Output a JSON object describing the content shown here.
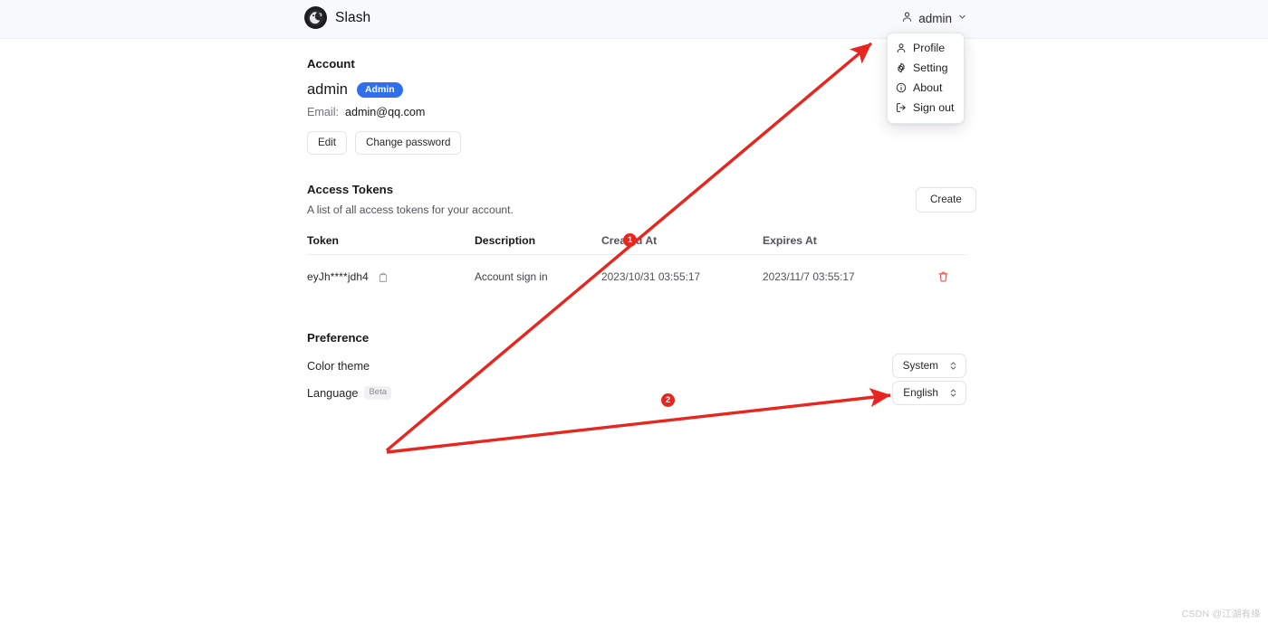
{
  "header": {
    "brand_name": "Slash",
    "logo_icon": "slash-globe-logo",
    "user_name": "admin",
    "user_icon": "user-icon",
    "chevron_icon": "chevron-down-icon"
  },
  "user_dropdown": {
    "items": [
      {
        "label": "Profile",
        "icon": "user-icon"
      },
      {
        "label": "Setting",
        "icon": "gear-icon"
      },
      {
        "label": "About",
        "icon": "info-circle-icon"
      },
      {
        "label": "Sign out",
        "icon": "sign-out-icon"
      }
    ]
  },
  "account": {
    "title": "Account",
    "username": "admin",
    "role_badge": "Admin",
    "email_label": "Email:",
    "email_value": "admin@qq.com",
    "edit_label": "Edit",
    "change_password_label": "Change password"
  },
  "access_tokens": {
    "title": "Access Tokens",
    "description": "A list of all access tokens for your account.",
    "create_label": "Create",
    "columns": [
      "Token",
      "Description",
      "Created At",
      "Expires At"
    ],
    "rows": [
      {
        "token": "eyJh****jdh4",
        "copy_icon": "copy-icon",
        "description": "Account sign in",
        "created_at": "2023/10/31 03:55:17",
        "expires_at": "2023/11/7 03:55:17",
        "delete_icon": "trash-icon"
      }
    ]
  },
  "preference": {
    "title": "Preference",
    "color_theme": {
      "label": "Color theme",
      "value": "System"
    },
    "language": {
      "label": "Language",
      "badge": "Beta",
      "value": "English"
    }
  },
  "annotations": {
    "markers": [
      {
        "number": "1"
      },
      {
        "number": "2"
      }
    ],
    "color": "#e8251f"
  },
  "watermark": "CSDN @江湖有缘",
  "colors": {
    "accent_blue": "#2f6fed",
    "header_bg": "#f8f9fb",
    "annotation_red": "#e8251f",
    "trash_red": "#d9534f"
  }
}
